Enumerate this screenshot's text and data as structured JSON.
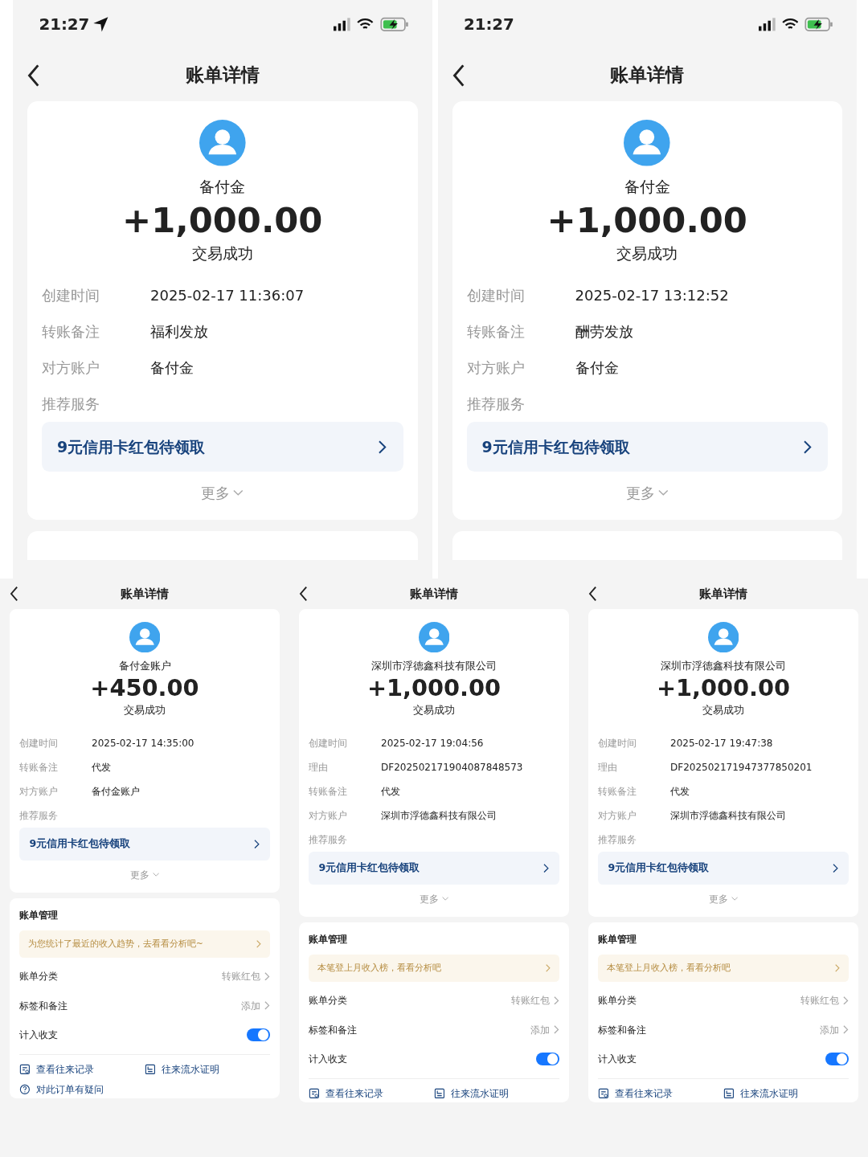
{
  "screens": [
    {
      "kind": "phone",
      "status_bar": {
        "time": "21:27",
        "location_arrow": true
      },
      "title": "账单详情",
      "payee": "备付金",
      "amount": "+1,000.00",
      "status": "交易成功",
      "details": [
        {
          "label": "创建时间",
          "value": "2025-02-17 11:36:07"
        },
        {
          "label": "转账备注",
          "value": "福利发放"
        },
        {
          "label": "对方账户",
          "value": "备付金"
        }
      ],
      "recommend_label": "推荐服务",
      "promo": "9元信用卡红包待领取",
      "more": "更多"
    },
    {
      "kind": "phone",
      "status_bar": {
        "time": "21:27",
        "location_arrow": false
      },
      "title": "账单详情",
      "payee": "备付金",
      "amount": "+1,000.00",
      "status": "交易成功",
      "details": [
        {
          "label": "创建时间",
          "value": "2025-02-17 13:12:52"
        },
        {
          "label": "转账备注",
          "value": "酬劳发放"
        },
        {
          "label": "对方账户",
          "value": "备付金"
        }
      ],
      "recommend_label": "推荐服务",
      "promo": "9元信用卡红包待领取",
      "more": "更多"
    },
    {
      "kind": "cropped",
      "title": "账单详情",
      "payee": "备付金账户",
      "amount": "+450.00",
      "status": "交易成功",
      "details": [
        {
          "label": "创建时间",
          "value": "2025-02-17 14:35:00"
        },
        {
          "label": "转账备注",
          "value": "代发"
        },
        {
          "label": "对方账户",
          "value": "备付金账户"
        }
      ],
      "recommend_label": "推荐服务",
      "promo": "9元信用卡红包待领取",
      "more": "更多",
      "management": {
        "title": "账单管理",
        "tip": "为您统计了最近的收入趋势，去看看分析吧~",
        "rows": [
          {
            "kind": "link",
            "label": "账单分类",
            "value": "转账红包"
          },
          {
            "kind": "link",
            "label": "标签和备注",
            "value": "添加"
          },
          {
            "kind": "toggle",
            "label": "计入收支",
            "on": true
          }
        ],
        "actions": [
          {
            "kind": "records",
            "label": "查看往来记录"
          },
          {
            "kind": "statement",
            "label": "往来流水证明"
          },
          {
            "kind": "question",
            "label": "对此订单有疑问"
          }
        ]
      }
    },
    {
      "kind": "cropped",
      "title": "账单详情",
      "payee": "深圳市浮德鑫科技有限公司",
      "amount": "+1,000.00",
      "status": "交易成功",
      "details": [
        {
          "label": "创建时间",
          "value": "2025-02-17 19:04:56"
        },
        {
          "label": "理由",
          "value": "DF202502171904087848573"
        },
        {
          "label": "转账备注",
          "value": "代发"
        },
        {
          "label": "对方账户",
          "value": "深圳市浮德鑫科技有限公司"
        }
      ],
      "recommend_label": "推荐服务",
      "promo": "9元信用卡红包待领取",
      "more": "更多",
      "management": {
        "title": "账单管理",
        "tip": "本笔登上月收入榜，看看分析吧",
        "rows": [
          {
            "kind": "link",
            "label": "账单分类",
            "value": "转账红包"
          },
          {
            "kind": "link",
            "label": "标签和备注",
            "value": "添加"
          },
          {
            "kind": "toggle",
            "label": "计入收支",
            "on": true
          }
        ],
        "actions": [
          {
            "kind": "records",
            "label": "查看往来记录"
          },
          {
            "kind": "statement",
            "label": "往来流水证明"
          }
        ]
      }
    },
    {
      "kind": "cropped",
      "title": "账单详情",
      "payee": "深圳市浮德鑫科技有限公司",
      "amount": "+1,000.00",
      "status": "交易成功",
      "details": [
        {
          "label": "创建时间",
          "value": "2025-02-17 19:47:38"
        },
        {
          "label": "理由",
          "value": "DF202502171947377850201"
        },
        {
          "label": "转账备注",
          "value": "代发"
        },
        {
          "label": "对方账户",
          "value": "深圳市浮德鑫科技有限公司"
        }
      ],
      "recommend_label": "推荐服务",
      "promo": "9元信用卡红包待领取",
      "more": "更多",
      "management": {
        "title": "账单管理",
        "tip": "本笔登上月收入榜，看看分析吧",
        "rows": [
          {
            "kind": "link",
            "label": "账单分类",
            "value": "转账红包"
          },
          {
            "kind": "link",
            "label": "标签和备注",
            "value": "添加"
          },
          {
            "kind": "toggle",
            "label": "计入收支",
            "on": true
          }
        ],
        "actions": [
          {
            "kind": "records",
            "label": "查看往来记录"
          },
          {
            "kind": "statement",
            "label": "往来流水证明"
          }
        ]
      }
    }
  ]
}
